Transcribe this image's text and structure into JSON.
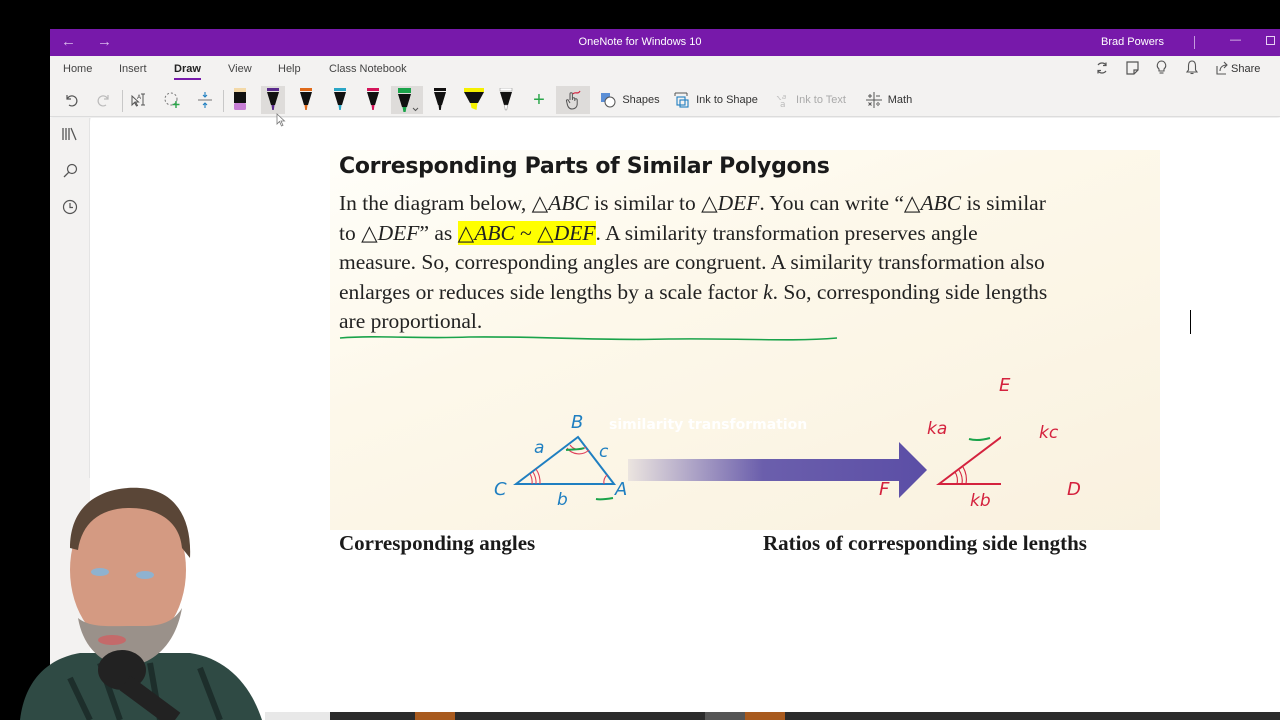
{
  "window": {
    "title": "OneNote for Windows 10",
    "user": "Brad Powers",
    "back_icon": "arrow-left-icon",
    "forward_icon": "arrow-right-icon"
  },
  "ribbon": {
    "tabs": [
      {
        "label": "Home",
        "active": false
      },
      {
        "label": "Insert",
        "active": false
      },
      {
        "label": "Draw",
        "active": true
      },
      {
        "label": "View",
        "active": false
      },
      {
        "label": "Help",
        "active": false
      },
      {
        "label": "Class Notebook",
        "active": false
      }
    ],
    "right_icons": [
      "sync-icon",
      "sticky-note-icon",
      "lightbulb-icon",
      "bell-icon"
    ],
    "share_label": "Share",
    "tools": {
      "undo": "undo-icon",
      "redo": "redo-icon",
      "lasso": "lasso-select-icon",
      "eraser_region": "add-space-icon",
      "insert_space": "insert-space-icon",
      "pens": [
        {
          "name": "eraser",
          "color": "#c77fd6",
          "cap": "#f3d9a8",
          "selected": false
        },
        {
          "name": "purple-pen",
          "color": "#5a2a8c",
          "cap": "#5a2a8c",
          "selected": true
        },
        {
          "name": "orange-pen",
          "color": "#e06a1a",
          "cap": "#e06a1a",
          "selected": false
        },
        {
          "name": "cyan-pen",
          "color": "#2aa6c6",
          "cap": "#2aa6c6",
          "selected": false
        },
        {
          "name": "magenta-pen",
          "color": "#d4145a",
          "cap": "#d4145a",
          "selected": false
        },
        {
          "name": "green-pen",
          "color": "#1aa34a",
          "cap": "#1aa34a",
          "selected": true
        },
        {
          "name": "black-pen",
          "color": "#111111",
          "cap": "#111111",
          "selected": false
        },
        {
          "name": "yellow-highlighter",
          "color": "#f5f000",
          "cap": "#f5f000",
          "selected": false
        },
        {
          "name": "white-pen",
          "color": "#ffffff",
          "cap": "#ffffff",
          "selected": false
        }
      ],
      "add_pen": "+",
      "touch_draw": "touch-draw-icon",
      "shapes_label": "Shapes",
      "ink_to_shape_label": "Ink to Shape",
      "ink_to_text_label": "Ink to Text",
      "math_label": "Math"
    }
  },
  "leftnav": [
    "notebooks-icon",
    "search-icon",
    "recent-icon"
  ],
  "content": {
    "heading": "Corresponding Parts of Similar Polygons",
    "para": {
      "l1a": "In the diagram below, △",
      "l1b": "ABC",
      "l1c": " is similar to △",
      "l1d": "DEF",
      "l1e": ". You can write “△",
      "l1f": "ABC",
      "l1g": " is similar",
      "l2a": "to △",
      "l2b": "DEF",
      "l2c": "” as ",
      "l2hl_a": "△",
      "l2hl_b": "ABC",
      "l2hl_c": " ~ △",
      "l2hl_d": "DEF",
      "l2d": ". A similarity transformation preserves angle",
      "l3": "measure. So, corresponding angles are congruent. A similarity transformation also",
      "l4a": "enlarges or reduces side lengths by a scale factor ",
      "l4b": "k",
      "l4c": ". So, corresponding side lengths",
      "l5": "are proportional."
    },
    "diagram": {
      "arrow_label": "similarity transformation",
      "small_triangle": {
        "A": "A",
        "B": "B",
        "C": "C",
        "a": "a",
        "b": "b",
        "c": "c"
      },
      "large_triangle": {
        "D": "D",
        "E": "E",
        "F": "F",
        "ka": "ka",
        "kb": "kb",
        "kc": "kc"
      },
      "caption_left": "Corresponding angles",
      "caption_right": "Ratios of corresponding side lengths"
    }
  },
  "colors": {
    "accent": "#7719aa",
    "highlight": "#ffff00",
    "ink_green": "#1aa34a",
    "triangle_blue": "#1f7fc1",
    "triangle_red": "#d4223e",
    "arrow": "#5b4ea6"
  }
}
